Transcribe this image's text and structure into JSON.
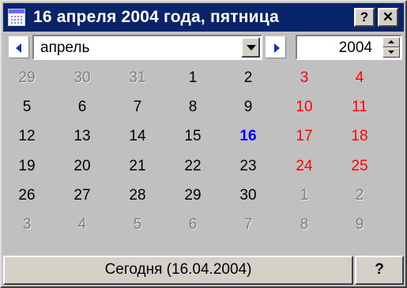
{
  "titlebar": {
    "title": "16 апреля 2004 года, пятница",
    "help_label": "?",
    "close_label": "✕"
  },
  "nav": {
    "month": "апрель",
    "year": "2004"
  },
  "calendar": {
    "weeks": [
      [
        {
          "day": "29",
          "kind": "other"
        },
        {
          "day": "30",
          "kind": "other"
        },
        {
          "day": "31",
          "kind": "other"
        },
        {
          "day": "1",
          "kind": "normal"
        },
        {
          "day": "2",
          "kind": "normal"
        },
        {
          "day": "3",
          "kind": "weekend"
        },
        {
          "day": "4",
          "kind": "weekend"
        }
      ],
      [
        {
          "day": "5",
          "kind": "normal"
        },
        {
          "day": "6",
          "kind": "normal"
        },
        {
          "day": "7",
          "kind": "normal"
        },
        {
          "day": "8",
          "kind": "normal"
        },
        {
          "day": "9",
          "kind": "normal"
        },
        {
          "day": "10",
          "kind": "weekend"
        },
        {
          "day": "11",
          "kind": "weekend"
        }
      ],
      [
        {
          "day": "12",
          "kind": "normal"
        },
        {
          "day": "13",
          "kind": "normal"
        },
        {
          "day": "14",
          "kind": "normal"
        },
        {
          "day": "15",
          "kind": "normal"
        },
        {
          "day": "16",
          "kind": "today"
        },
        {
          "day": "17",
          "kind": "weekend"
        },
        {
          "day": "18",
          "kind": "weekend"
        }
      ],
      [
        {
          "day": "19",
          "kind": "normal"
        },
        {
          "day": "20",
          "kind": "normal"
        },
        {
          "day": "21",
          "kind": "normal"
        },
        {
          "day": "22",
          "kind": "normal"
        },
        {
          "day": "23",
          "kind": "normal"
        },
        {
          "day": "24",
          "kind": "weekend"
        },
        {
          "day": "25",
          "kind": "weekend"
        }
      ],
      [
        {
          "day": "26",
          "kind": "normal"
        },
        {
          "day": "27",
          "kind": "normal"
        },
        {
          "day": "28",
          "kind": "normal"
        },
        {
          "day": "29",
          "kind": "normal"
        },
        {
          "day": "30",
          "kind": "normal"
        },
        {
          "day": "1",
          "kind": "other"
        },
        {
          "day": "2",
          "kind": "other"
        }
      ],
      [
        {
          "day": "3",
          "kind": "other"
        },
        {
          "day": "4",
          "kind": "other"
        },
        {
          "day": "5",
          "kind": "other"
        },
        {
          "day": "6",
          "kind": "other"
        },
        {
          "day": "7",
          "kind": "other"
        },
        {
          "day": "8",
          "kind": "other"
        },
        {
          "day": "9",
          "kind": "other"
        }
      ]
    ]
  },
  "footer": {
    "today_label": "Сегодня (16.04.2004)",
    "help_label": "?"
  },
  "colors": {
    "titlebar": "#0a246a",
    "weekend": "#ff0000",
    "today": "#0000ff",
    "other_month": "#808080"
  },
  "icons": {
    "title": "calendar-icon",
    "prev": "left-arrow-icon",
    "next": "right-arrow-icon",
    "dropdown": "chevron-down-icon"
  }
}
